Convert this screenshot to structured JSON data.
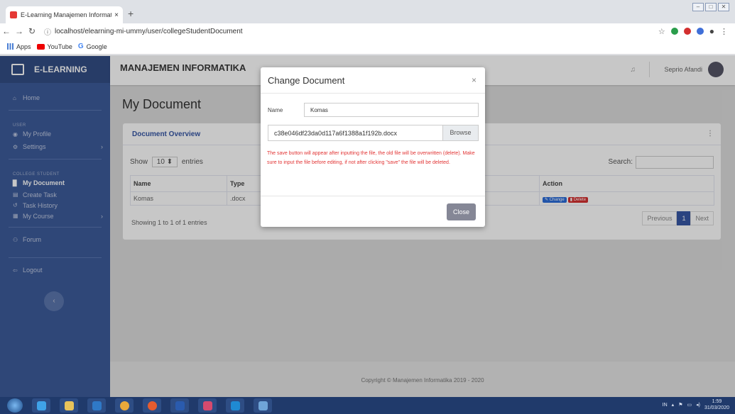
{
  "browser": {
    "tab_title": "E-Learning Manajemen Informati",
    "tab_close": "×",
    "new_tab": "+",
    "url": "localhost/elearning-mi-ummy/user/collegeStudentDocument",
    "bookmarks": [
      "Apps",
      "YouTube",
      "Google"
    ]
  },
  "sidebar": {
    "brand": "E-LEARNING",
    "home": "Home",
    "user_heading": "USER",
    "my_profile": "My Profile",
    "settings": "Settings",
    "college_heading": "COLLEGE STUDENT",
    "my_document": "My Document",
    "create_task": "Create Task",
    "task_history": "Task History",
    "my_course": "My Course",
    "forum": "Forum",
    "logout": "Logout",
    "collapse": "‹"
  },
  "topbar": {
    "program": "MANAJEMEN INFORMATIKA",
    "user_name": "Seprio Afandi"
  },
  "page": {
    "title": "My Document"
  },
  "card": {
    "title": "Document Overview",
    "show": "Show",
    "entries_value": "10",
    "entries": "entries",
    "search": "Search:",
    "columns": [
      "Name",
      "Type",
      "Action"
    ],
    "row": {
      "name": "Komas",
      "type": ".docx",
      "change": "Change",
      "delete": "Delete"
    },
    "showing": "Showing 1 to 1 of 1 entries",
    "previous": "Previous",
    "page": "1",
    "next": "Next"
  },
  "footer": {
    "text": "Copyright © Manajemen Informatika 2019 - 2020"
  },
  "modal": {
    "title": "Change Document",
    "close_x": "×",
    "name_label": "Name",
    "name_value": "Komas",
    "file_name": "c38e046df23da0d117a6f1388a1f192b.docx",
    "browse": "Browse",
    "warning": "The save button will appear after inputting the file, the old file will be overwritten (delete). Make sure to input the file before editing, if not after clicking \"save\" the file will be deleted.",
    "close_button": "Close"
  },
  "taskbar": {
    "lang": "IN",
    "time": "1:59",
    "date": "31/03/2020"
  },
  "colors": {
    "sidebar": "#3d5c9a",
    "accent": "#3656a5",
    "warning_text": "#e23434",
    "close_button": "#858796"
  }
}
